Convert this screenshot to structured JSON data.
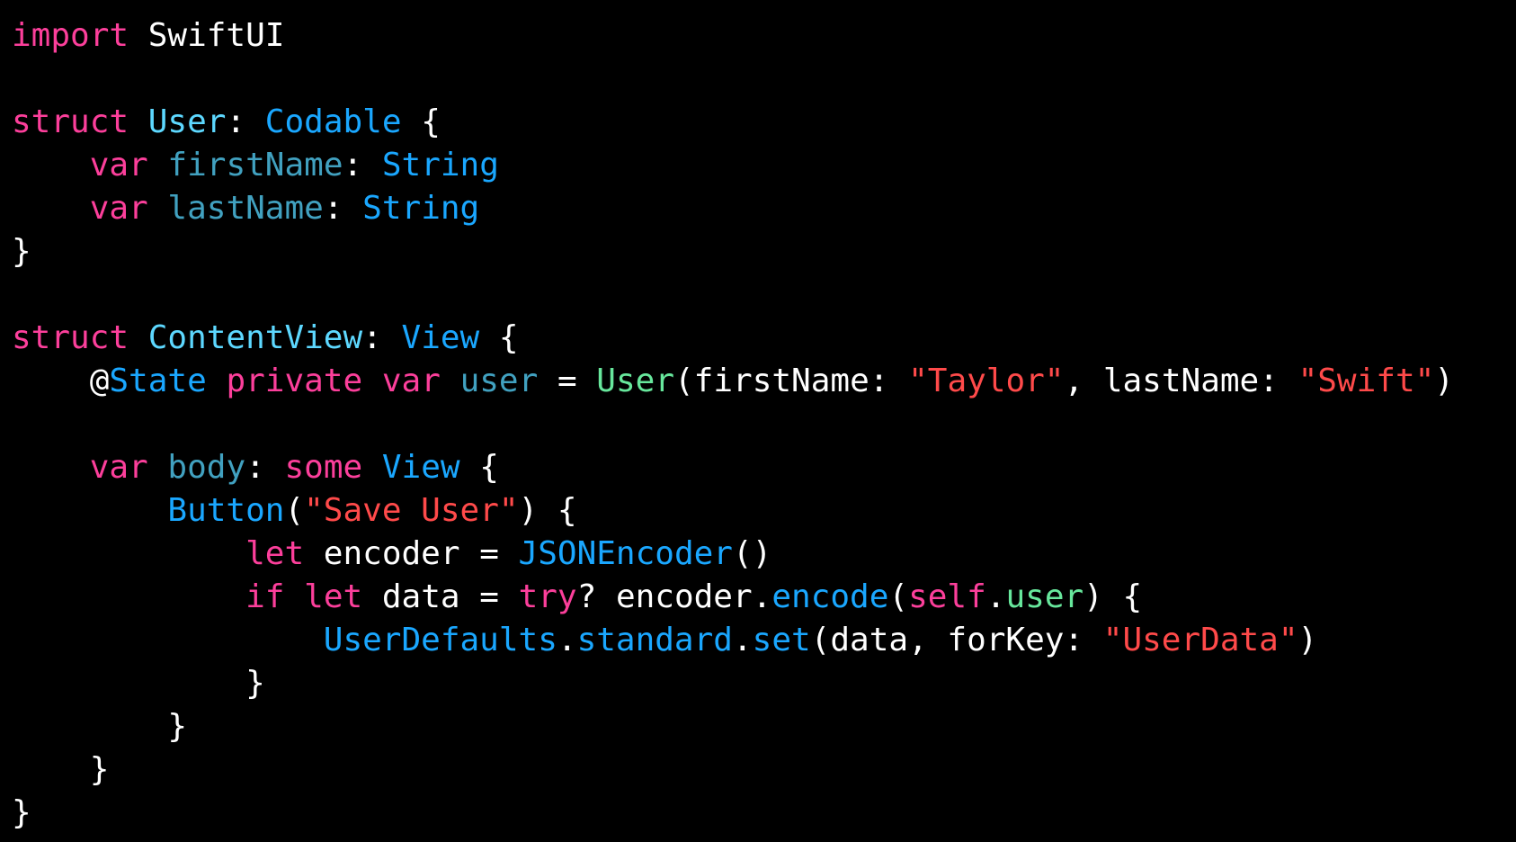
{
  "theme": {
    "background": "#000000",
    "colors": {
      "keyword": "#fc3f9b",
      "type_decl": "#5dd8ff",
      "type": "#1aa7ff",
      "property": "#41a1c0",
      "member": "#30c5d5",
      "call": "#67e79c",
      "string": "#ff4a4a",
      "plain": "#ffffff"
    }
  },
  "code": {
    "language": "Swift",
    "lines": [
      [
        {
          "t": "import",
          "k": "keyword"
        },
        {
          "t": " SwiftUI",
          "k": "plain"
        }
      ],
      [],
      [
        {
          "t": "struct",
          "k": "keyword"
        },
        {
          "t": " ",
          "k": "plain"
        },
        {
          "t": "User",
          "k": "type_decl"
        },
        {
          "t": ": ",
          "k": "plain"
        },
        {
          "t": "Codable",
          "k": "type"
        },
        {
          "t": " {",
          "k": "plain"
        }
      ],
      [
        {
          "t": "    ",
          "k": "plain"
        },
        {
          "t": "var",
          "k": "keyword"
        },
        {
          "t": " ",
          "k": "plain"
        },
        {
          "t": "firstName",
          "k": "property"
        },
        {
          "t": ": ",
          "k": "plain"
        },
        {
          "t": "String",
          "k": "type"
        }
      ],
      [
        {
          "t": "    ",
          "k": "plain"
        },
        {
          "t": "var",
          "k": "keyword"
        },
        {
          "t": " ",
          "k": "plain"
        },
        {
          "t": "lastName",
          "k": "property"
        },
        {
          "t": ": ",
          "k": "plain"
        },
        {
          "t": "String",
          "k": "type"
        }
      ],
      [
        {
          "t": "}",
          "k": "plain"
        }
      ],
      [],
      [
        {
          "t": "struct",
          "k": "keyword"
        },
        {
          "t": " ",
          "k": "plain"
        },
        {
          "t": "ContentView",
          "k": "type_decl"
        },
        {
          "t": ": ",
          "k": "plain"
        },
        {
          "t": "View",
          "k": "type"
        },
        {
          "t": " {",
          "k": "plain"
        }
      ],
      [
        {
          "t": "    @",
          "k": "plain"
        },
        {
          "t": "State",
          "k": "type"
        },
        {
          "t": " ",
          "k": "plain"
        },
        {
          "t": "private",
          "k": "keyword"
        },
        {
          "t": " ",
          "k": "plain"
        },
        {
          "t": "var",
          "k": "keyword"
        },
        {
          "t": " ",
          "k": "plain"
        },
        {
          "t": "user",
          "k": "property"
        },
        {
          "t": " = ",
          "k": "plain"
        },
        {
          "t": "User",
          "k": "call"
        },
        {
          "t": "(firstName: ",
          "k": "plain"
        },
        {
          "t": "\"Taylor\"",
          "k": "string"
        },
        {
          "t": ", lastName: ",
          "k": "plain"
        },
        {
          "t": "\"Swift\"",
          "k": "string"
        },
        {
          "t": ")",
          "k": "plain"
        }
      ],
      [],
      [
        {
          "t": "    ",
          "k": "plain"
        },
        {
          "t": "var",
          "k": "keyword"
        },
        {
          "t": " ",
          "k": "plain"
        },
        {
          "t": "body",
          "k": "property"
        },
        {
          "t": ": ",
          "k": "plain"
        },
        {
          "t": "some",
          "k": "keyword"
        },
        {
          "t": " ",
          "k": "plain"
        },
        {
          "t": "View",
          "k": "type"
        },
        {
          "t": " {",
          "k": "plain"
        }
      ],
      [
        {
          "t": "        ",
          "k": "plain"
        },
        {
          "t": "Button",
          "k": "type"
        },
        {
          "t": "(",
          "k": "plain"
        },
        {
          "t": "\"Save User\"",
          "k": "string"
        },
        {
          "t": ") {",
          "k": "plain"
        }
      ],
      [
        {
          "t": "            ",
          "k": "plain"
        },
        {
          "t": "let",
          "k": "keyword"
        },
        {
          "t": " encoder = ",
          "k": "plain"
        },
        {
          "t": "JSONEncoder",
          "k": "type"
        },
        {
          "t": "()",
          "k": "plain"
        }
      ],
      [
        {
          "t": "            ",
          "k": "plain"
        },
        {
          "t": "if",
          "k": "keyword"
        },
        {
          "t": " ",
          "k": "plain"
        },
        {
          "t": "let",
          "k": "keyword"
        },
        {
          "t": " data = ",
          "k": "plain"
        },
        {
          "t": "try",
          "k": "keyword"
        },
        {
          "t": "? encoder.",
          "k": "plain"
        },
        {
          "t": "encode",
          "k": "type"
        },
        {
          "t": "(",
          "k": "plain"
        },
        {
          "t": "self",
          "k": "keyword"
        },
        {
          "t": ".",
          "k": "plain"
        },
        {
          "t": "user",
          "k": "call"
        },
        {
          "t": ") {",
          "k": "plain"
        }
      ],
      [
        {
          "t": "                ",
          "k": "plain"
        },
        {
          "t": "UserDefaults",
          "k": "type"
        },
        {
          "t": ".",
          "k": "plain"
        },
        {
          "t": "standard",
          "k": "type"
        },
        {
          "t": ".",
          "k": "plain"
        },
        {
          "t": "set",
          "k": "type"
        },
        {
          "t": "(data, forKey: ",
          "k": "plain"
        },
        {
          "t": "\"UserData\"",
          "k": "string"
        },
        {
          "t": ")",
          "k": "plain"
        }
      ],
      [
        {
          "t": "            }",
          "k": "plain"
        }
      ],
      [
        {
          "t": "        }",
          "k": "plain"
        }
      ],
      [
        {
          "t": "    }",
          "k": "plain"
        }
      ],
      [
        {
          "t": "}",
          "k": "plain"
        }
      ]
    ]
  }
}
